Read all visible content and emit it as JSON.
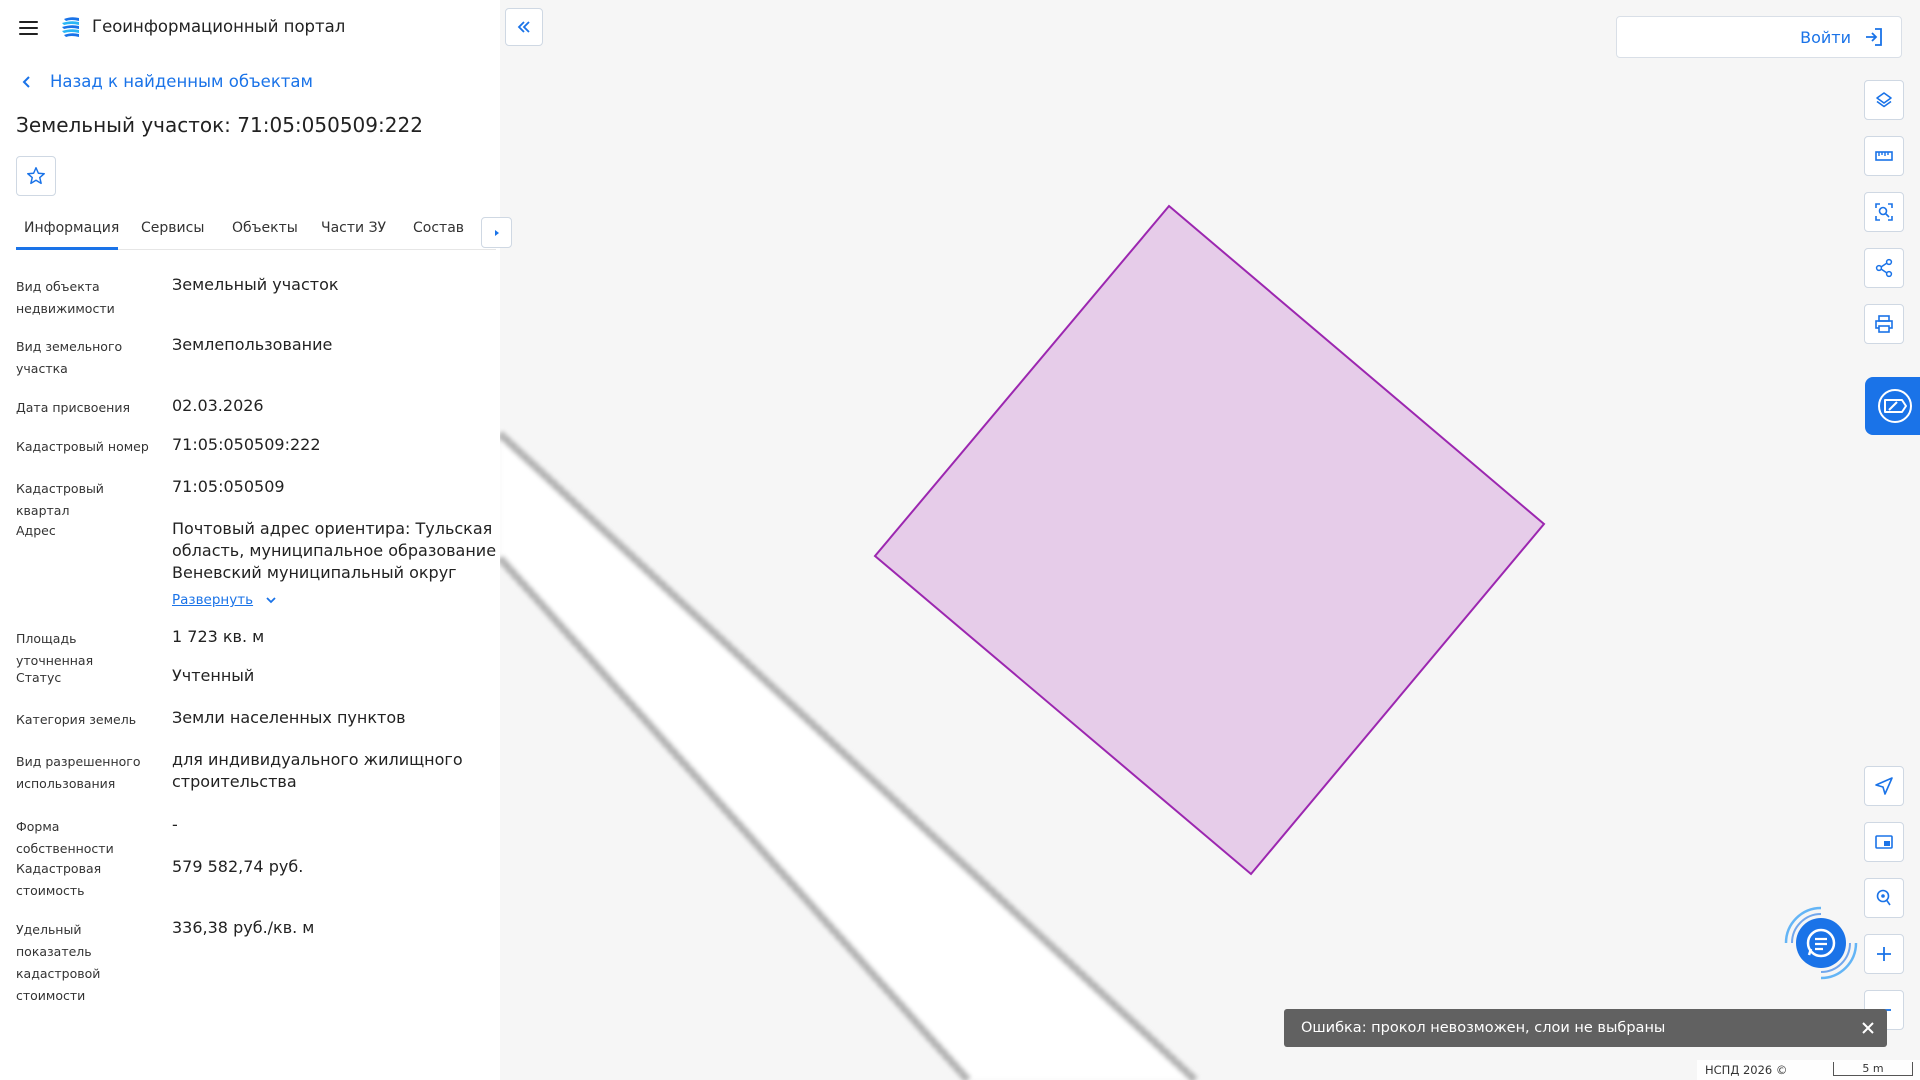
{
  "header": {
    "app_title": "Геоинформационный портал",
    "menu_icon": "hamburger-icon",
    "logo_icon": "portal-logo-icon"
  },
  "back_link": {
    "label": "Назад к найденным объектам",
    "icon": "chevron-left-icon"
  },
  "page_title": "Земельный участок: 71:05:050509:222",
  "favorite_icon": "star-icon",
  "tabs": [
    {
      "label": "Информация",
      "active": true
    },
    {
      "label": "Сервисы",
      "active": false
    },
    {
      "label": "Объекты",
      "active": false
    },
    {
      "label": "Части ЗУ",
      "active": false
    },
    {
      "label": "Состав",
      "active": false
    }
  ],
  "properties": [
    {
      "label": "Вид объекта недвижимости",
      "value": "Земельный участок"
    },
    {
      "label": "Вид земельного участка",
      "value": "Землепользование"
    },
    {
      "label": "Дата присвоения",
      "value": "02.03.2026"
    },
    {
      "label": "Кадастровый номер",
      "value": "71:05:050509:222"
    },
    {
      "label": "Кадастровый квартал",
      "value": "71:05:050509"
    },
    {
      "label": "Адрес",
      "value": "Почтовый адрес ориентира: Тульская область, муниципальное образование Веневский муниципальный округ",
      "expand": "Развернуть"
    },
    {
      "label": "Площадь уточненная",
      "value": "1 723 кв. м"
    },
    {
      "label": "Статус",
      "value": "Учтенный"
    },
    {
      "label": "Категория земель",
      "value": "Земли населенных пунктов"
    },
    {
      "label": "Вид разрешенного использования",
      "value": "для индивидуального жилищного строительства"
    },
    {
      "label": "Форма собственности",
      "value": "-"
    },
    {
      "label": "Кадастровая стоимость",
      "value": "579 582,74 руб."
    },
    {
      "label": "Удельный показатель кадастровой стоимости",
      "value": "336,38 руб./кв. м"
    }
  ],
  "map": {
    "login_label": "Войти",
    "login_icon": "login-icon",
    "tools_top": [
      "layers-icon",
      "ruler-icon",
      "area-select-icon",
      "share-icon",
      "print-icon"
    ],
    "side_tab_icon": "map-panel-icon",
    "tools_bottom": [
      "navigate-icon",
      "minimap-icon",
      "location-pin-icon",
      "zoom-in-icon",
      "zoom-out-icon"
    ],
    "chat_icon": "chat-icon",
    "parcel_fill": "#e6cce9",
    "parcel_stroke": "#9c27b0",
    "accent": "#1a73e8"
  },
  "toast": {
    "message": "Ошибка: прокол невозможен, слои не выбраны",
    "close_icon": "close-icon"
  },
  "footer": {
    "copyright": "НСПД 2026 ©",
    "scale_label": "5 m"
  }
}
